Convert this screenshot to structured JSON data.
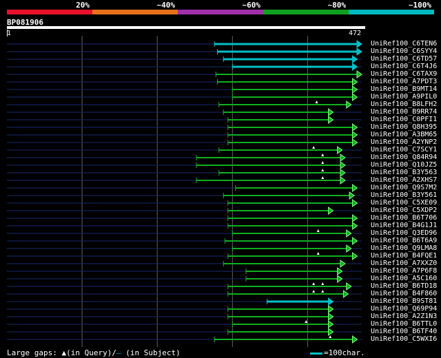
{
  "identity_legend": {
    "labels": [
      "20%",
      "~40%",
      "~60%",
      "~80%",
      "~100%"
    ],
    "colors": [
      "#e8102a",
      "#e8701a",
      "#a030a8",
      "#10a020",
      "#00b8c0"
    ]
  },
  "query": {
    "id": "BP081906",
    "start": "1",
    "end": "472",
    "length": 472
  },
  "colors": {
    "background": "#000000",
    "gap_line": "#1a2a6e",
    "grid_line": "#606060",
    "identity_100": "#00c0c8",
    "identity_80": "#10b020",
    "arrowhead_80": "#80ff80"
  },
  "hits": [
    {
      "label": "UniRef100_C6TEN6",
      "start": 276,
      "end": 472,
      "identity": "~100%",
      "markers": []
    },
    {
      "label": "UniRef100_C6SYY4",
      "start": 280,
      "end": 472,
      "identity": "~100%",
      "markers": []
    },
    {
      "label": "UniRef100_C6TD57",
      "start": 288,
      "end": 466,
      "identity": "~100%",
      "markers": []
    },
    {
      "label": "UniRef100_C6T4J6",
      "start": 300,
      "end": 466,
      "identity": "~100%",
      "markers": []
    },
    {
      "label": "UniRef100_C6TAX9",
      "start": 278,
      "end": 472,
      "identity": "~80%",
      "markers": []
    },
    {
      "label": "UniRef100_A7PDT3",
      "start": 280,
      "end": 466,
      "identity": "~80%",
      "markers": []
    },
    {
      "label": "UniRef100_B9MT14",
      "start": 300,
      "end": 466,
      "identity": "~80%",
      "markers": []
    },
    {
      "label": "UniRef100_A9PIL0",
      "start": 300,
      "end": 466,
      "identity": "~80%",
      "markers": []
    },
    {
      "label": "UniRef100_B8LFH2",
      "start": 282,
      "end": 458,
      "identity": "~80%",
      "markers": [
        412
      ]
    },
    {
      "label": "UniRef100_B9RR74",
      "start": 288,
      "end": 434,
      "identity": "~80%",
      "markers": []
    },
    {
      "label": "UniRef100_C0PFI1",
      "start": 294,
      "end": 434,
      "identity": "~80%",
      "markers": []
    },
    {
      "label": "UniRef100_Q8H395",
      "start": 294,
      "end": 466,
      "identity": "~80%",
      "markers": []
    },
    {
      "label": "UniRef100_A3BM65",
      "start": 294,
      "end": 466,
      "identity": "~80%",
      "markers": []
    },
    {
      "label": "UniRef100_A2YNP2",
      "start": 294,
      "end": 466,
      "identity": "~80%",
      "markers": []
    },
    {
      "label": "UniRef100_C7SCY1",
      "start": 282,
      "end": 446,
      "identity": "~80%",
      "markers": [
        408
      ]
    },
    {
      "label": "UniRef100_Q84R94",
      "start": 252,
      "end": 450,
      "identity": "~80%",
      "markers": [
        420
      ]
    },
    {
      "label": "UniRef100_Q10JZ5",
      "start": 252,
      "end": 450,
      "identity": "~80%",
      "markers": [
        420
      ]
    },
    {
      "label": "UniRef100_B3Y563",
      "start": 282,
      "end": 450,
      "identity": "~80%",
      "markers": [
        420
      ]
    },
    {
      "label": "UniRef100_A2XHS7",
      "start": 252,
      "end": 450,
      "identity": "~80%",
      "markers": [
        420
      ]
    },
    {
      "label": "UniRef100_Q9S7M2",
      "start": 304,
      "end": 466,
      "identity": "~80%",
      "markers": []
    },
    {
      "label": "UniRef100_B3Y561",
      "start": 288,
      "end": 462,
      "identity": "~80%",
      "markers": []
    },
    {
      "label": "UniRef100_C5XE09",
      "start": 294,
      "end": 466,
      "identity": "~80%",
      "markers": []
    },
    {
      "label": "UniRef100_C5XDP2",
      "start": 294,
      "end": 434,
      "identity": "~80%",
      "markers": []
    },
    {
      "label": "UniRef100_B6T706",
      "start": 294,
      "end": 466,
      "identity": "~80%",
      "markers": []
    },
    {
      "label": "UniRef100_B4G1J1",
      "start": 294,
      "end": 466,
      "identity": "~80%",
      "markers": []
    },
    {
      "label": "UniRef100_Q3ED96",
      "start": 300,
      "end": 458,
      "identity": "~80%",
      "markers": [
        414
      ]
    },
    {
      "label": "UniRef100_B6T6A9",
      "start": 290,
      "end": 466,
      "identity": "~80%",
      "markers": []
    },
    {
      "label": "UniRef100_Q9LMA8",
      "start": 300,
      "end": 458,
      "identity": "~80%",
      "markers": []
    },
    {
      "label": "UniRef100_B4FQE1",
      "start": 294,
      "end": 466,
      "identity": "~80%",
      "markers": [
        414
      ]
    },
    {
      "label": "UniRef100_A7XXZ0",
      "start": 288,
      "end": 450,
      "identity": "~80%",
      "markers": []
    },
    {
      "label": "UniRef100_A7P6F8",
      "start": 318,
      "end": 446,
      "identity": "~80%",
      "markers": []
    },
    {
      "label": "UniRef100_A5C160",
      "start": 318,
      "end": 446,
      "identity": "~80%",
      "markers": []
    },
    {
      "label": "UniRef100_B6TD18",
      "start": 294,
      "end": 458,
      "identity": "~80%",
      "markers": [
        408,
        420
      ]
    },
    {
      "label": "UniRef100_B4F860",
      "start": 294,
      "end": 454,
      "identity": "~80%",
      "markers": [
        408,
        420
      ]
    },
    {
      "label": "UniRef100_B9ST81",
      "start": 346,
      "end": 434,
      "identity": "~100%",
      "markers": []
    },
    {
      "label": "UniRef100_Q69P94",
      "start": 294,
      "end": 434,
      "identity": "~80%",
      "markers": []
    },
    {
      "label": "UniRef100_A2Z1N3",
      "start": 294,
      "end": 434,
      "identity": "~80%",
      "markers": []
    },
    {
      "label": "UniRef100_B6TTL0",
      "start": 300,
      "end": 434,
      "identity": "~80%",
      "markers": [
        398
      ]
    },
    {
      "label": "UniRef100_B6TF40",
      "start": 294,
      "end": 434,
      "identity": "~80%",
      "markers": []
    },
    {
      "label": "UniRef100_C5WXI6",
      "start": 276,
      "end": 466,
      "identity": "~80%",
      "markers": [
        430
      ]
    }
  ],
  "footer": {
    "prefix": "Large gaps:",
    "query_marker": "▲",
    "query_text": "(in Query)/",
    "subject_marker": "–",
    "subject_text": " (in Subject)",
    "scale_text": "=100char."
  }
}
